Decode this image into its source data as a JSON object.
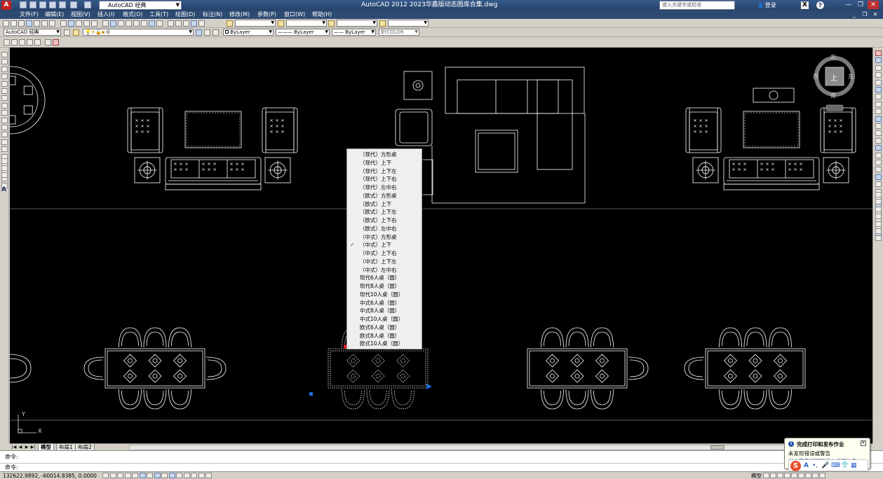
{
  "titlebar": {
    "workspace": "AutoCAD 经典",
    "window_title": "AutoCAD 2012    2023华鑫版动态图库合集.dwg",
    "help_search_placeholder": "键入关键字或短语",
    "login": "登录"
  },
  "menu": {
    "items": [
      "文件(F)",
      "编辑(E)",
      "视图(V)",
      "插入(I)",
      "格式(O)",
      "工具(T)",
      "绘图(D)",
      "标注(N)",
      "修改(M)",
      "参数(P)",
      "窗口(W)",
      "帮助(H)"
    ]
  },
  "toolbars": {
    "workspace_combo": "AutoCAD 经典",
    "layer_combo": "0",
    "color_combo": "ByLayer",
    "linetype_combo": "ByLayer",
    "lineweight_combo": "ByLayer",
    "plotstyle_combo": "BYCOLOR"
  },
  "viewcube": {
    "north": "北",
    "south": "南",
    "east": "东",
    "west": "西",
    "top_face": "上"
  },
  "context_menu": {
    "items": [
      {
        "label": "（现代）方形桌",
        "checked": false
      },
      {
        "label": "（现代）上下",
        "checked": false
      },
      {
        "label": "（现代）上下左",
        "checked": false
      },
      {
        "label": "（现代）上下右",
        "checked": false
      },
      {
        "label": "（现代）左中右",
        "checked": false
      },
      {
        "label": "（欧式）方形桌",
        "checked": false
      },
      {
        "label": "（欧式）上下",
        "checked": false
      },
      {
        "label": "（欧式）上下左",
        "checked": false
      },
      {
        "label": "（欧式）上下右",
        "checked": false
      },
      {
        "label": "（欧式）左中右",
        "checked": false
      },
      {
        "label": "（中式）方形桌",
        "checked": false
      },
      {
        "label": "（中式）上下",
        "checked": true
      },
      {
        "label": "（中式）上下右",
        "checked": false
      },
      {
        "label": "（中式）上下左",
        "checked": false
      },
      {
        "label": "（中式）左中右",
        "checked": false
      },
      {
        "label": "现代6人桌（圆）",
        "checked": false
      },
      {
        "label": "现代8人桌（圆）",
        "checked": false
      },
      {
        "label": "现代10人桌（圆）",
        "checked": false
      },
      {
        "label": "中式6人桌（圆）",
        "checked": false
      },
      {
        "label": "中式8人桌（圆）",
        "checked": false
      },
      {
        "label": "中式10人桌（圆）",
        "checked": false
      },
      {
        "label": "欧式6人桌（圆）",
        "checked": false
      },
      {
        "label": "欧式8人桌（圆）",
        "checked": false
      },
      {
        "label": "欧式10人桌（圆）",
        "checked": false
      }
    ]
  },
  "ucs": {
    "x": "X",
    "y": "Y"
  },
  "tabs": {
    "items": [
      {
        "label": "模型",
        "active": true
      },
      {
        "label": "布局1",
        "active": false
      },
      {
        "label": "布局2",
        "active": false
      }
    ]
  },
  "command": {
    "line1": "命令:",
    "line2": "命令:"
  },
  "status": {
    "coords": "132622.9892, -60014.8385, 0.0000",
    "model_label": "模型"
  },
  "notification": {
    "title": "完成打印和发布作业",
    "message": "未发现错误或警告",
    "link": "单击查看打印和发布详细信息..."
  },
  "colors": {
    "canvas_bg": "#000000",
    "drawing_line": "#ffffff",
    "grip_blue": "#1e6fd9",
    "grip_red": "#e02020",
    "menu_check": "#1a4fa0"
  }
}
